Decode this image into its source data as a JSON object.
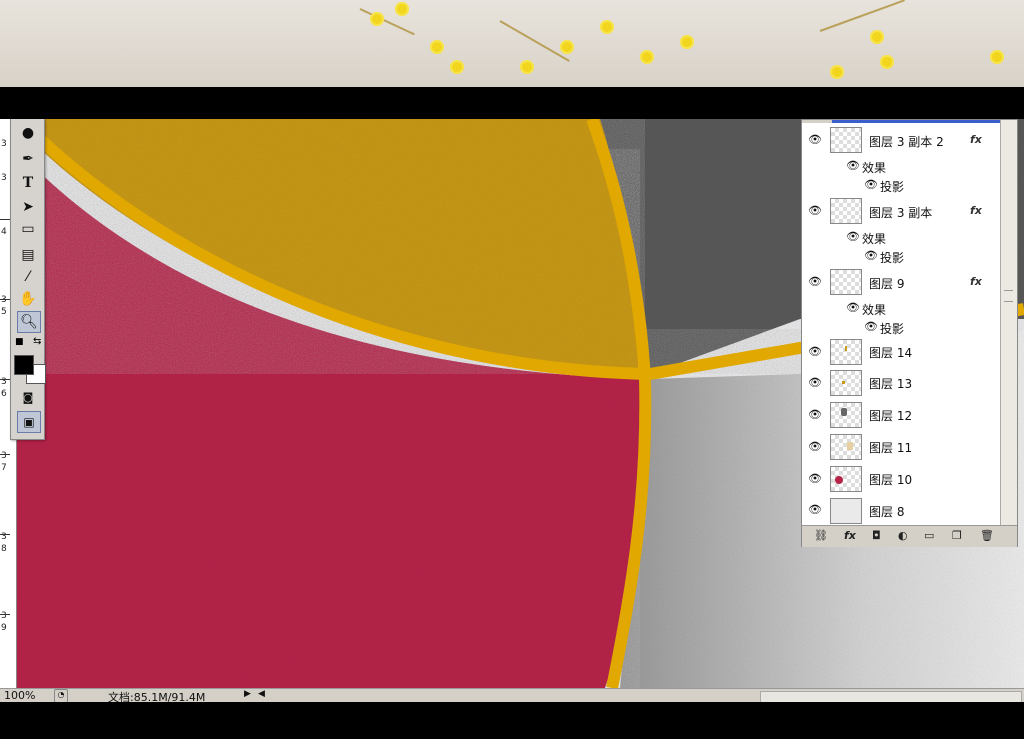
{
  "statusbar": {
    "zoom": "100%",
    "doc_info": "文档:85.1M/91.4M"
  },
  "ruler": {
    "numbers": [
      "3",
      "3",
      "4",
      "3",
      "5",
      "3",
      "6",
      "3",
      "7",
      "3",
      "8",
      "3",
      "9"
    ]
  },
  "layers": [
    {
      "name": "图层 3 副本 2",
      "fx": "fx",
      "effects_label": "效果",
      "effect": "投影"
    },
    {
      "name": "图层 3 副本",
      "fx": "fx",
      "effects_label": "效果",
      "effect": "投影"
    },
    {
      "name": "图层 9",
      "fx": "fx",
      "effects_label": "效果",
      "effect": "投影"
    },
    {
      "name": "图层 14"
    },
    {
      "name": "图层 13"
    },
    {
      "name": "图层 12"
    },
    {
      "name": "图层 11"
    },
    {
      "name": "图层 10"
    },
    {
      "name": "图层 8"
    }
  ],
  "icons": {
    "eye": "eye-icon",
    "fx": "fx-icon"
  },
  "colors": {
    "gold": "#c99a14",
    "gold_line": "#e0a800",
    "crimson": "#b8234a",
    "dark_gray": "#4a4a4a",
    "light_gray": "#dcdcdc"
  },
  "toolbox": {
    "foreground_color": "#000000",
    "background_color": "#ffffff"
  }
}
